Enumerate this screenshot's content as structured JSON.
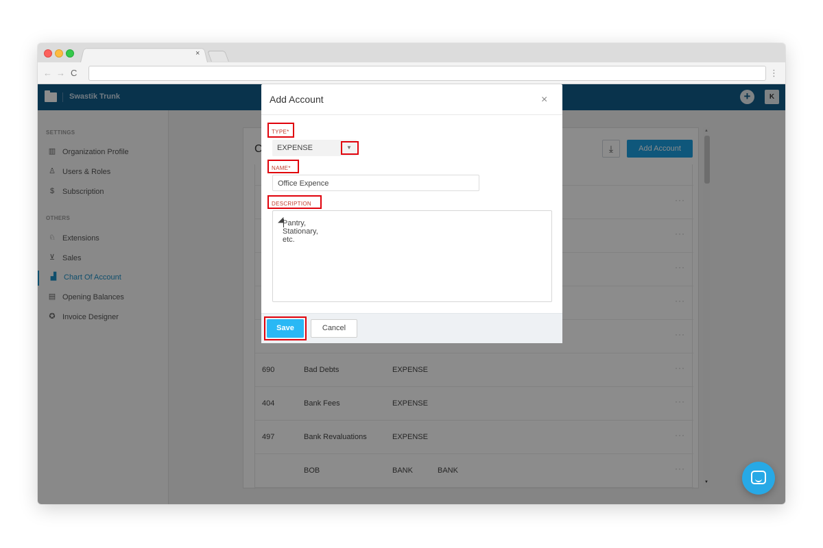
{
  "browser": {
    "tab_close": "×",
    "nav_back": "←",
    "nav_forward": "→",
    "nav_reload": "C",
    "url": "",
    "menu": "⋮"
  },
  "header": {
    "org_name": "Swastik Trunk",
    "plus": "+",
    "avatar_letter": "K",
    "bar_color": "#125d8a"
  },
  "sidebar": {
    "settings_heading": "SETTINGS",
    "settings_items": [
      {
        "icon": "organization-icon",
        "label": "Organization Profile"
      },
      {
        "icon": "users-icon",
        "label": "Users & Roles"
      },
      {
        "icon": "subscription-icon",
        "label": "Subscription"
      }
    ],
    "others_heading": "OTHERS",
    "others_items": [
      {
        "icon": "extensions-icon",
        "label": "Extensions"
      },
      {
        "icon": "cart-icon",
        "label": "Sales"
      },
      {
        "icon": "chart-icon",
        "label": "Chart Of Account",
        "active": true
      },
      {
        "icon": "calendar-icon",
        "label": "Opening Balances"
      },
      {
        "icon": "palette-icon",
        "label": "Invoice Designer"
      }
    ],
    "active_color": "#1c8fc5"
  },
  "main": {
    "title_initial": "C",
    "download_icon": "download-icon",
    "add_account_label": "Add Account",
    "rows": [
      {
        "code": "",
        "name": "",
        "type": "",
        "subtype": ""
      },
      {
        "code": "",
        "name": "",
        "type": "",
        "subtype": ""
      },
      {
        "code": "",
        "name": "",
        "type": "",
        "subtype": ""
      },
      {
        "code": "",
        "name": "",
        "type": "",
        "subtype": ""
      },
      {
        "code": "",
        "name": "",
        "type": "",
        "subtype": ""
      },
      {
        "code": "690",
        "name": "Bad Debts",
        "type": "EXPENSE",
        "subtype": ""
      },
      {
        "code": "404",
        "name": "Bank Fees",
        "type": "EXPENSE",
        "subtype": ""
      },
      {
        "code": "497",
        "name": "Bank Revaluations",
        "type": "EXPENSE",
        "subtype": ""
      },
      {
        "code": "",
        "name": "BOB",
        "type": "BANK",
        "subtype": "BANK"
      }
    ],
    "row_menu": "···"
  },
  "modal": {
    "title": "Add Account",
    "close": "×",
    "type_label": "TYPE*",
    "type_value": "EXPENSE",
    "type_arrow": "▼",
    "name_label": "NAME*",
    "name_value": "Office Expence",
    "description_label": "DESCRIPTION",
    "description_value": "Pantry, Stationary, etc.",
    "save_label": "Save",
    "cancel_label": "Cancel",
    "highlight_color": "#e0000a"
  }
}
